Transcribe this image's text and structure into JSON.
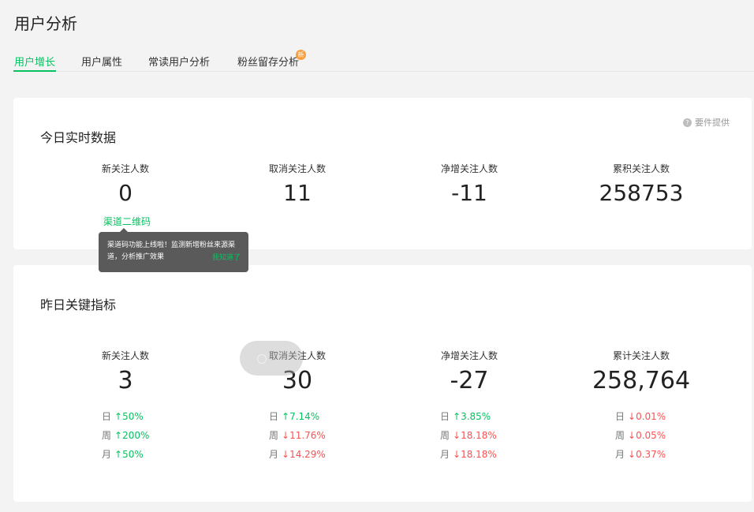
{
  "page_title": "用户分析",
  "tabs": [
    {
      "label": "用户增长",
      "active": true
    },
    {
      "label": "用户属性"
    },
    {
      "label": "常读用户分析"
    },
    {
      "label": "粉丝留存分析",
      "badge": "新"
    }
  ],
  "realtime": {
    "title": "今日实时数据",
    "help_text": "要件提供",
    "metrics": [
      {
        "label": "新关注人数",
        "value": "0"
      },
      {
        "label": "取消关注人数",
        "value": "11"
      },
      {
        "label": "净增关注人数",
        "value": "-11"
      },
      {
        "label": "累积关注人数",
        "value": "258753"
      }
    ],
    "channel_link": "渠道二维码",
    "tooltip": {
      "text": "渠道码功能上线啦！监测新增粉丝来源渠道，分析推广效果",
      "ok": "我知道了"
    }
  },
  "yesterday": {
    "title": "昨日关键指标",
    "metrics": [
      {
        "label": "新关注人数",
        "value": "3",
        "compare": [
          {
            "period": "日",
            "arrow": "↑",
            "pct": "50%",
            "dir": "up"
          },
          {
            "period": "周",
            "arrow": "↑",
            "pct": "200%",
            "dir": "up"
          },
          {
            "period": "月",
            "arrow": "↑",
            "pct": "50%",
            "dir": "up"
          }
        ]
      },
      {
        "label": "取消关注人数",
        "value": "30",
        "compare": [
          {
            "period": "日",
            "arrow": "↑",
            "pct": "7.14%",
            "dir": "up"
          },
          {
            "period": "周",
            "arrow": "↓",
            "pct": "11.76%",
            "dir": "down"
          },
          {
            "period": "月",
            "arrow": "↓",
            "pct": "14.29%",
            "dir": "down"
          }
        ]
      },
      {
        "label": "净增关注人数",
        "value": "-27",
        "compare": [
          {
            "period": "日",
            "arrow": "↑",
            "pct": "3.85%",
            "dir": "up"
          },
          {
            "period": "周",
            "arrow": "↓",
            "pct": "18.18%",
            "dir": "down"
          },
          {
            "period": "月",
            "arrow": "↓",
            "pct": "18.18%",
            "dir": "down"
          }
        ]
      },
      {
        "label": "累计关注人数",
        "value": "258,764",
        "compare": [
          {
            "period": "日",
            "arrow": "↓",
            "pct": "0.01%",
            "dir": "down"
          },
          {
            "period": "周",
            "arrow": "↓",
            "pct": "0.05%",
            "dir": "down"
          },
          {
            "period": "月",
            "arrow": "↓",
            "pct": "0.37%",
            "dir": "down"
          }
        ]
      }
    ]
  },
  "colors": {
    "accent": "#07c160",
    "down": "#fa5151",
    "badge": "#fa9d3b"
  }
}
